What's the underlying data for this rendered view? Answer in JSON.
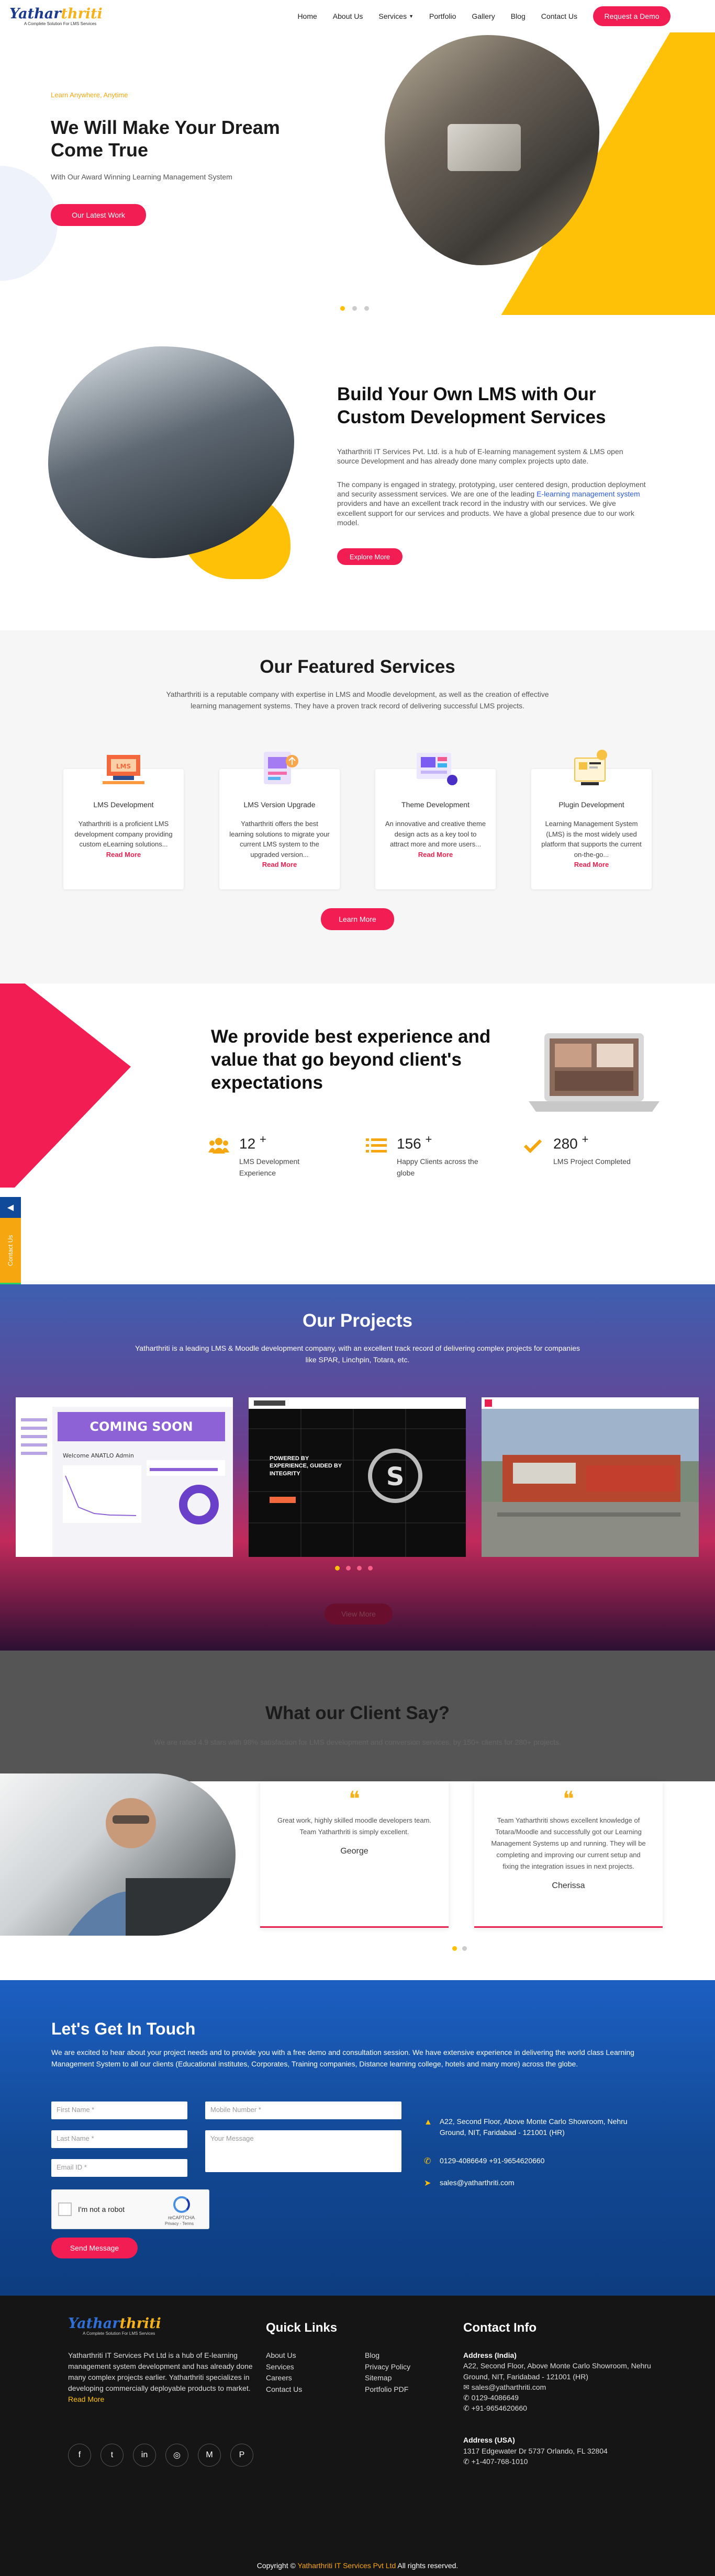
{
  "header": {
    "logo_text_a": "Yathar",
    "logo_text_b": "thriti",
    "logo_tagline": "A Complete Solution For LMS Services",
    "nav": [
      "Home",
      "About Us",
      "Services",
      "Portfolio",
      "Gallery",
      "Blog",
      "Contact Us"
    ],
    "cta": "Request a Demo"
  },
  "hero": {
    "eyebrow": "Learn Anywhere, Anytime",
    "title": "We Will Make Your Dream Come True",
    "subtitle": "With Our Award Winning Learning Management System",
    "button": "Our Latest Work",
    "active_slide": 1,
    "slide_count": 3
  },
  "about": {
    "title": "Build Your Own LMS with Our Custom Development Services",
    "p1": "Yatharthriti IT Services Pvt. Ltd. is a hub of E-learning management system & LMS open source Development and has already done many complex projects upto date.",
    "p2_a": "The company is engaged in strategy, prototyping, user centered design, production deployment and security assessment services. We are one of the leading ",
    "p2_link": "E-learning management system",
    "p2_b": " providers and have an excellent track record in the industry with our services. We give excellent support for our services and products. We have a global presence due to our work model.",
    "button": "Explore More"
  },
  "services": {
    "title": "Our Featured Services",
    "intro": "Yatharthriti is a reputable company with expertise in LMS and Moodle development, as well as the creation of effective learning management systems. They have a proven track record of delivering successful LMS projects.",
    "cards": [
      {
        "title": "LMS Development",
        "text": "Yatharthriti is a proficient LMS development company providing custom eLearning solutions...",
        "more": "Read More",
        "icon": "lms-board-icon"
      },
      {
        "title": "LMS Version Upgrade",
        "text": "Yatharthriti offers the best learning solutions to migrate your current LMS system to the upgraded version...",
        "more": "Read More",
        "icon": "upgrade-icon"
      },
      {
        "title": "Theme Development",
        "text": "An innovative and creative theme design acts as a key tool to attract more and more users...",
        "more": "Read More",
        "icon": "theme-icon"
      },
      {
        "title": "Plugin Development",
        "text": "Learning Management System (LMS) is the most widely used platform that supports the current on-the-go...",
        "more": "Read More",
        "icon": "plugin-icon"
      }
    ],
    "button": "Learn More"
  },
  "stats": {
    "title": "We provide best experience and value that go beyond client's expectations",
    "items": [
      {
        "num": "12",
        "plus": "+",
        "label": "LMS Development Experience",
        "icon": "users-icon"
      },
      {
        "num": "156",
        "plus": "+",
        "label": "Happy Clients across the globe",
        "icon": "list-icon"
      },
      {
        "num": "280",
        "plus": "+",
        "label": "LMS Project Completed",
        "icon": "check-icon"
      }
    ]
  },
  "dock": {
    "contact_label": "Contact Us"
  },
  "projects": {
    "title": "Our Projects",
    "intro": "Yatharthriti is a leading LMS & Moodle development company, with an excellent track record of delivering complex projects for companies like SPAR, Linchpin, Totara, etc.",
    "shot1_banner": "COMING SOON",
    "shot1_welcome": "Welcome ANATLO Admin",
    "shot2_text": "POWERED BY EXPERIENCE, GUIDED BY INTEGRITY",
    "button": "View More",
    "active_slide": 1,
    "slide_count": 4
  },
  "testimonials": {
    "title": "What our Client Say?",
    "intro": "We are rated 4.9 stars with 98% satisfaction for LMS development and conversion services, by 150+ clients for 280+ projects.",
    "items": [
      {
        "text": "Great work, highly skilled moodle developers team. Team Yatharthriti is simply excellent.",
        "name": "George"
      },
      {
        "text": "Team Yatharthriti shows excellent knowledge of Totara/Moodle and successfully got our Learning Management Systems up and running. They will be completing and improving our current setup and fixing the integration issues in next projects.",
        "name": "Cherissa"
      }
    ]
  },
  "contact": {
    "title": "Let's Get In Touch",
    "intro": "We are excited to hear about your project needs and to provide you with a free demo and consultation session. We have extensive experience in delivering the world class Learning Management System to all our clients (Educational institutes, Corporates, Training companies, Distance learning college, hotels and many more) across the globe.",
    "placeholders": {
      "first": "First Name *",
      "mobile": "Mobile Number *",
      "last": "Last Name *",
      "message": "Your Message",
      "email": "Email ID *"
    },
    "captcha_label": "I'm not a robot",
    "captcha_brand": "reCAPTCHA",
    "captcha_terms": "Privacy - Terms",
    "button": "Send Message",
    "address": "A22, Second Floor, Above Monte Carlo Showroom, Nehru Ground, NIT, Faridabad - 121001 (HR)",
    "phones": "0129-4086649 +91-9654620660",
    "email": "sales@yatharthriti.com"
  },
  "footer": {
    "about": "Yatharthriti IT Services Pvt Ltd is a hub of E-learning management system development and has already done many complex projects earlier. Yatharthriti specializes in developing commercially deployable products to market.",
    "more": "Read More",
    "quick_title": "Quick Links",
    "links_col1": [
      "About Us",
      "Services",
      "Careers",
      "Contact Us"
    ],
    "links_col2": [
      "Blog",
      "Privacy Policy",
      "Sitemap",
      "Portfolio PDF"
    ],
    "info_title": "Contact Info",
    "india_title": "Address (India)",
    "india_addr": "A22, Second Floor, Above Monte Carlo Showroom, Nehru Ground, NIT, Faridabad - 121001 (HR)",
    "india_email": "sales@yatharthriti.com",
    "india_phone1": "0129-4086649",
    "india_phone2": "+91-9654620660",
    "usa_title": "Address (USA)",
    "usa_addr": "1317 Edgewater Dr 5737 Orlando, FL 32804",
    "usa_phone": "+1-407-768-1010",
    "copy_a": "Copyright © ",
    "copy_b": "Yatharthriti IT Services Pvt Ltd",
    "copy_c": " All rights reserved."
  }
}
